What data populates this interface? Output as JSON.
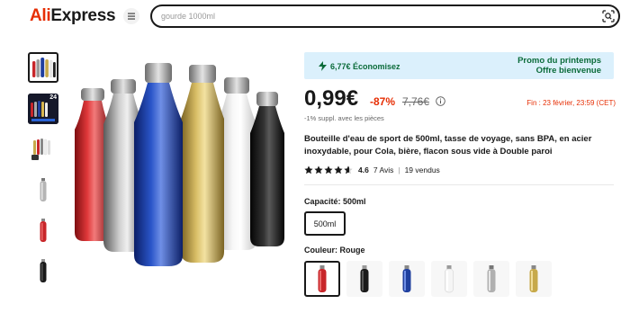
{
  "header": {
    "logo_part1": "Ali",
    "logo_part2": "Express",
    "search_placeholder": "gourde 1000ml"
  },
  "thumbnails": [
    {
      "name": "thumb-group-bottles",
      "active": true
    },
    {
      "name": "thumb-badge-24",
      "badge": "24"
    },
    {
      "name": "thumb-cups-set"
    },
    {
      "name": "thumb-silver-bottle"
    },
    {
      "name": "thumb-red-bottle"
    },
    {
      "name": "thumb-black-bottle"
    }
  ],
  "promo": {
    "save": "6,77€ Économisez",
    "title": "Promo du printemps",
    "subtitle": "Offre bienvenue"
  },
  "price": {
    "current": "0,99€",
    "discount": "-87%",
    "original": "7,76€",
    "deadline": "Fin :  23 février, 23:59 (CET)",
    "extra": "-1% suppl. avec les pièces"
  },
  "product": {
    "title": "Bouteille d'eau de sport de 500ml, tasse de voyage, sans BPA, en acier inoxydable, pour Cola, bière, flacon sous vide à Double paroi",
    "rating": "4.6",
    "reviews": "7 Avis",
    "sold": "19 vendus",
    "stars_filled": 4.6
  },
  "capacity": {
    "label": "Capacité: 500ml",
    "option": "500ml"
  },
  "color": {
    "label": "Couleur: Rouge",
    "options": [
      "Rouge",
      "Noir",
      "Bleu",
      "Blanc",
      "Argent",
      "Or"
    ]
  },
  "colors": {
    "accent_red": "#e62e04",
    "promo_green": "#0b6b3a",
    "promo_bg": "#dbf0fc"
  }
}
